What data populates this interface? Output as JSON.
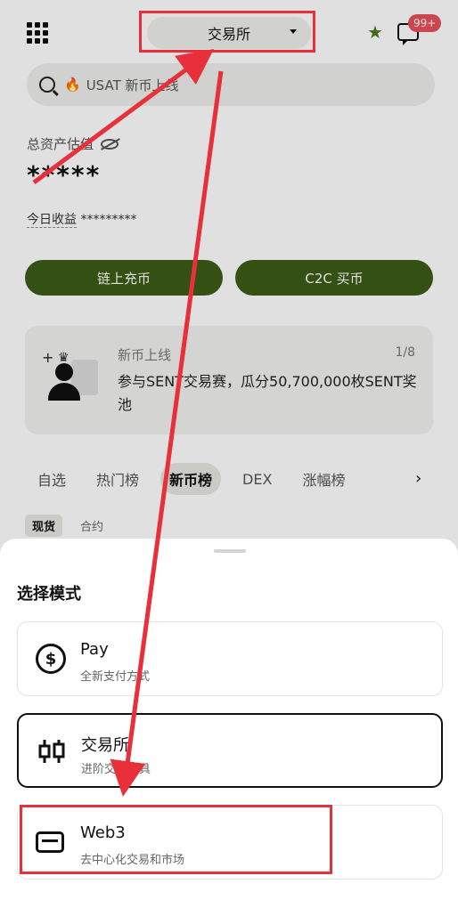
{
  "header": {
    "mode_label": "交易所",
    "message_badge": "99+"
  },
  "search": {
    "placeholder": "USAT 新币上线"
  },
  "assets": {
    "label": "总资产估值",
    "value": "*****",
    "pnl_label": "今日收益",
    "pnl_value": "*********"
  },
  "actions": {
    "deposit": "链上充币",
    "c2c": "C2C 买币"
  },
  "announcement": {
    "title": "新币上线",
    "page": "1/8",
    "text": "参与SENT交易赛，瓜分50,700,000枚SENT奖池"
  },
  "tabs": [
    "自选",
    "热门榜",
    "新币榜",
    "DEX",
    "涨幅榜"
  ],
  "active_tab": "新币榜",
  "subtabs": [
    "现货",
    "合约"
  ],
  "sheet": {
    "title": "选择模式",
    "options": [
      {
        "name": "Pay",
        "desc": "全新支付方式",
        "icon": "dollar-circle-icon"
      },
      {
        "name": "交易所",
        "desc": "进阶交易工具",
        "icon": "candlestick-icon"
      },
      {
        "name": "Web3",
        "desc": "去中心化交易和市场",
        "icon": "wallet-card-icon"
      }
    ],
    "selected": "交易所"
  },
  "colors": {
    "accent_green": "#3c5d16",
    "annotation_red": "#e8303a",
    "badge_red": "#e8505b"
  }
}
